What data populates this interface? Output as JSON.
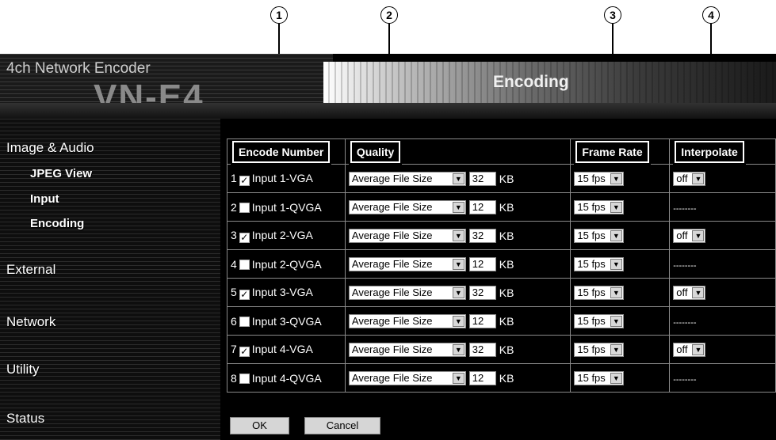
{
  "callouts": [
    "1",
    "2",
    "3",
    "4"
  ],
  "header": {
    "subtitle": "4ch Network Encoder",
    "model": "VN-E4",
    "page_title": "Encoding"
  },
  "sidebar": {
    "items": [
      {
        "label": "Image & Audio",
        "level": "main"
      },
      {
        "label": "JPEG View",
        "level": "sub"
      },
      {
        "label": "Input",
        "level": "sub"
      },
      {
        "label": "Encoding",
        "level": "sub"
      },
      {
        "label": "External",
        "level": "main"
      },
      {
        "label": "Network",
        "level": "main"
      },
      {
        "label": "Utility",
        "level": "main"
      },
      {
        "label": "Status",
        "level": "main"
      }
    ]
  },
  "table": {
    "headers": {
      "encode_number": "Encode Number",
      "quality": "Quality",
      "frame_rate": "Frame Rate",
      "interpolate": "Interpolate"
    },
    "rows": [
      {
        "num": "1",
        "checked": true,
        "input": "Input 1-VGA",
        "quality": "Average File Size",
        "size": "32",
        "unit": "KB",
        "fps": "15 fps",
        "interp": "off"
      },
      {
        "num": "2",
        "checked": false,
        "input": "Input 1-QVGA",
        "quality": "Average File Size",
        "size": "12",
        "unit": "KB",
        "fps": "15 fps",
        "interp": "--------"
      },
      {
        "num": "3",
        "checked": true,
        "input": "Input 2-VGA",
        "quality": "Average File Size",
        "size": "32",
        "unit": "KB",
        "fps": "15 fps",
        "interp": "off"
      },
      {
        "num": "4",
        "checked": false,
        "input": "Input 2-QVGA",
        "quality": "Average File Size",
        "size": "12",
        "unit": "KB",
        "fps": "15 fps",
        "interp": "--------"
      },
      {
        "num": "5",
        "checked": true,
        "input": "Input 3-VGA",
        "quality": "Average File Size",
        "size": "32",
        "unit": "KB",
        "fps": "15 fps",
        "interp": "off"
      },
      {
        "num": "6",
        "checked": false,
        "input": "Input 3-QVGA",
        "quality": "Average File Size",
        "size": "12",
        "unit": "KB",
        "fps": "15 fps",
        "interp": "--------"
      },
      {
        "num": "7",
        "checked": true,
        "input": "Input 4-VGA",
        "quality": "Average File Size",
        "size": "32",
        "unit": "KB",
        "fps": "15 fps",
        "interp": "off"
      },
      {
        "num": "8",
        "checked": false,
        "input": "Input 4-QVGA",
        "quality": "Average File Size",
        "size": "12",
        "unit": "KB",
        "fps": "15 fps",
        "interp": "--------"
      }
    ]
  },
  "buttons": {
    "ok": "OK",
    "cancel": "Cancel"
  }
}
